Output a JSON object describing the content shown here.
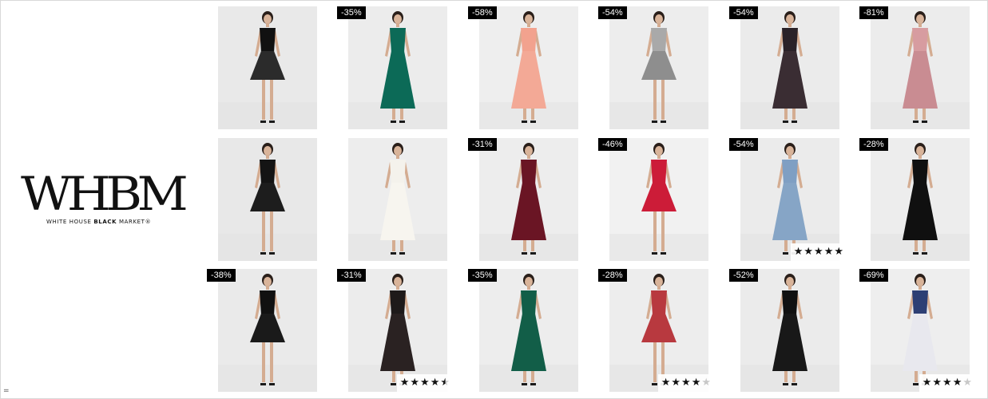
{
  "brand": {
    "mark": "WHBM",
    "sub_part1": "WHITE HOUSE ",
    "sub_part2": "BLACK",
    "sub_part3": " MARKET",
    "sub_reg": "®"
  },
  "footer_glyph": "=",
  "products": [
    {
      "badge": "",
      "dress": "#111111",
      "skirt": "#2b2b2b",
      "rating": 0,
      "bg": "#e9e9e9"
    },
    {
      "badge": "-35%",
      "dress": "#0c6a57",
      "skirt": "#0c6a57",
      "rating": 0,
      "bg": "#ececec"
    },
    {
      "badge": "-58%",
      "dress": "#f2a28e",
      "skirt": "#f3a996",
      "rating": 0,
      "bg": "#eeeeee"
    },
    {
      "badge": "-54%",
      "dress": "#a9a9a9",
      "skirt": "#8e8e8e",
      "rating": 0,
      "bg": "#ededed"
    },
    {
      "badge": "-54%",
      "dress": "#2a2228",
      "skirt": "#3a2d33",
      "rating": 0,
      "bg": "#ebebeb"
    },
    {
      "badge": "-81%",
      "dress": "#d79ca0",
      "skirt": "#c98c92",
      "rating": 0,
      "bg": "#ececec"
    },
    {
      "badge": "",
      "dress": "#141414",
      "skirt": "#1d1d1d",
      "rating": 0,
      "bg": "#e8e8e8"
    },
    {
      "badge": "",
      "dress": "#f4f2ec",
      "skirt": "#f7f5ef",
      "rating": 0,
      "bg": "#ededed"
    },
    {
      "badge": "-31%",
      "dress": "#6a1524",
      "skirt": "#6a1524",
      "rating": 0,
      "bg": "#ededed"
    },
    {
      "badge": "-46%",
      "dress": "#cc1c38",
      "skirt": "#cc1c38",
      "rating": 0,
      "bg": "#f1f1f1"
    },
    {
      "badge": "-54%",
      "dress": "#7f9fc3",
      "skirt": "#86a5c6",
      "rating": 5,
      "bg": "#ebebeb"
    },
    {
      "badge": "-28%",
      "dress": "#101010",
      "skirt": "#101010",
      "rating": 0,
      "bg": "#ededed"
    },
    {
      "badge": "-38%",
      "dress": "#111111",
      "skirt": "#1a1a1a",
      "rating": 0,
      "bg": "#eaeaea"
    },
    {
      "badge": "-31%",
      "dress": "#1e1a1a",
      "skirt": "#2a2222",
      "rating": 4.5,
      "bg": "#ececec"
    },
    {
      "badge": "-35%",
      "dress": "#125e48",
      "skirt": "#125e48",
      "rating": 0,
      "bg": "#ededed"
    },
    {
      "badge": "-28%",
      "dress": "#b8393f",
      "skirt": "#b8393f",
      "rating": 4,
      "bg": "#ededed"
    },
    {
      "badge": "-52%",
      "dress": "#111111",
      "skirt": "#181818",
      "rating": 0,
      "bg": "#ebebeb"
    },
    {
      "badge": "-69%",
      "dress": "#2d3f74",
      "skirt": "#e8e8ee",
      "rating": 4,
      "bg": "#eeeeee"
    }
  ]
}
